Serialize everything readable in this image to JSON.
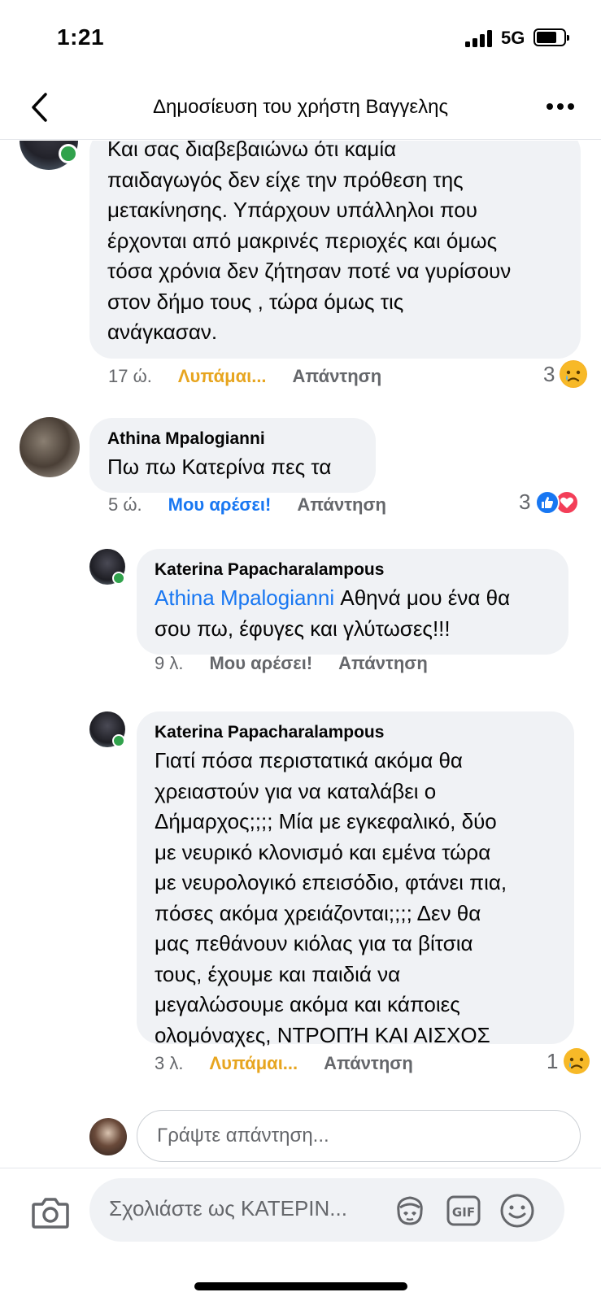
{
  "status": {
    "time": "1:21",
    "network": "5G"
  },
  "header": {
    "title": "Δημοσίευση του χρήστη Βαγγελης"
  },
  "comments": [
    {
      "text_lines": [
        "Και σας διαβεβαιώνω ότι καμία",
        "παιδαγωγός δεν είχε την πρόθεση της",
        "μετακίνησης. Υπάρχουν υπάλληλοι που",
        "έρχονται από μακρινές περιοχές και όμως",
        "τόσα χρόνια δεν ζήτησαν ποτέ να γυρίσουν",
        "στον δήμο τους , τώρα όμως τις",
        "ανάγκασαν."
      ],
      "time": "17 ώ.",
      "reaction_label": "Λυπάμαι...",
      "reply_label": "Απάντηση",
      "reaction_count": "3",
      "reaction_icons": [
        "sad-icon"
      ]
    },
    {
      "author": "Athina Mpalogianni",
      "text": "Πω πω Κατερίνα πες τα",
      "time": "5 ώ.",
      "reaction_label": "Μου αρέσει!",
      "reply_label": "Απάντηση",
      "reaction_count": "3",
      "reaction_icons": [
        "like-icon",
        "love-icon"
      ]
    },
    {
      "author": "Katerina Papacharalampous",
      "mention": "Athina Mpalogianni",
      "text_first": " Αθηνά μου ένα θα",
      "text_second": "σου πω, έφυγες και γλύτωσες!!!",
      "time": "9 λ.",
      "reaction_label": "Μου αρέσει!",
      "reply_label": "Απάντηση"
    },
    {
      "author": "Katerina Papacharalampous",
      "text_lines": [
        "Γιατί πόσα περιστατικά ακόμα θα",
        "χρειαστούν για να καταλάβει ο",
        "Δήμαρχος;;;; Μία με εγκεφαλικό, δύο",
        "με νευρικό κλονισμό και εμένα τώρα",
        "με νευρολογικό επεισόδιο, φτάνει πια,",
        "πόσες ακόμα χρειάζονται;;;; Δεν θα",
        "μας πεθάνουν κιόλας για τα βίτσια",
        "τους, έχουμε και παιδιά να",
        "μεγαλώσουμε ακόμα και κάποιες",
        "ολομόναχες, ΝΤΡΟΠΉ ΚΑΙ ΑΙΣΧΟΣ"
      ],
      "time": "3 λ.",
      "reaction_label": "Λυπάμαι...",
      "reply_label": "Απάντηση",
      "reaction_count": "1",
      "reaction_icons": [
        "sad-icon"
      ]
    }
  ],
  "reply_box": {
    "placeholder": "Γράψτε απάντηση..."
  },
  "composer": {
    "placeholder": "Σχολιάστε ως ΚΑΤΕΡΙΝ..."
  },
  "colors": {
    "accent": "#1877f2",
    "sad": "#e7a51f",
    "love": "#f33e58",
    "online": "#31a24c",
    "bubble": "#f0f2f5"
  }
}
